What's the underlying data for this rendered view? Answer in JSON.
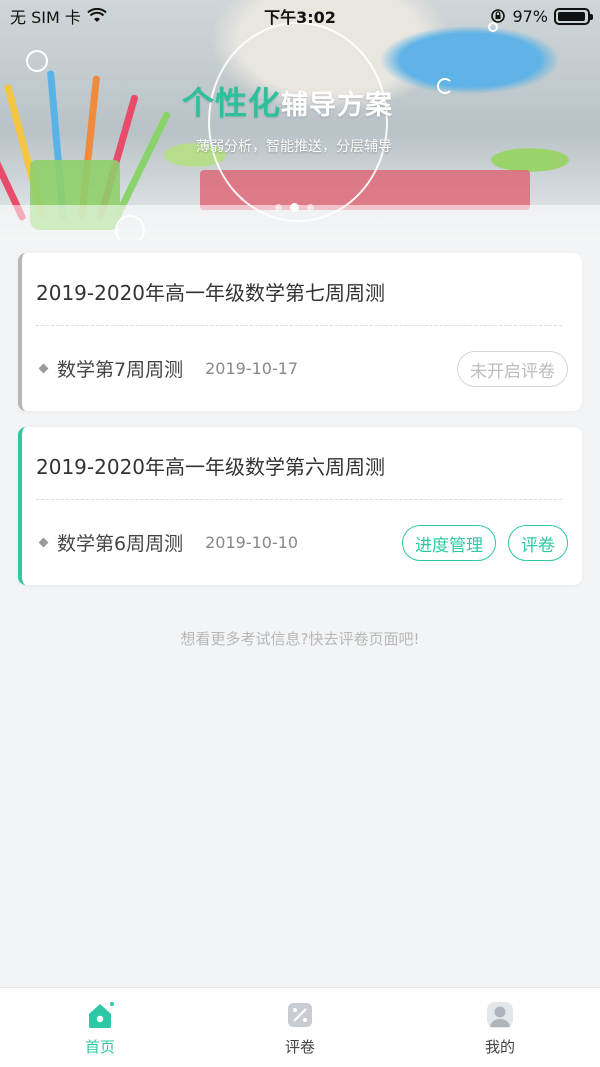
{
  "status_bar": {
    "carrier": "无 SIM 卡",
    "time": "下午3:02",
    "battery_percent": "97%",
    "battery_level": 0.97
  },
  "banner": {
    "title_primary": "个性化",
    "title_secondary": "辅导方案",
    "subtitle": "薄弱分析，智能推送，分层辅导",
    "active_slide_index": 1,
    "slide_count": 3
  },
  "cards": [
    {
      "title": "2019-2020年高一年级数学第七周周测",
      "subject": "数学第7周周测",
      "date": "2019-10-17",
      "actions": [
        "未开启评卷"
      ],
      "active": false
    },
    {
      "title": "2019-2020年高一年级数学第六周周测",
      "subject": "数学第6周周测",
      "date": "2019-10-10",
      "actions": [
        "进度管理",
        "评卷"
      ],
      "active": true
    }
  ],
  "hint": "想看更多考试信息?快去评卷页面吧!",
  "tabbar": {
    "items": [
      {
        "label": "首页",
        "icon": "home-icon",
        "active": true
      },
      {
        "label": "评卷",
        "icon": "grade-icon",
        "active": false
      },
      {
        "label": "我的",
        "icon": "profile-icon",
        "active": false
      }
    ]
  },
  "colors": {
    "accent": "#2dc8a5",
    "inactive_border": "#b7b7b7",
    "background": "#f3f4f6"
  }
}
